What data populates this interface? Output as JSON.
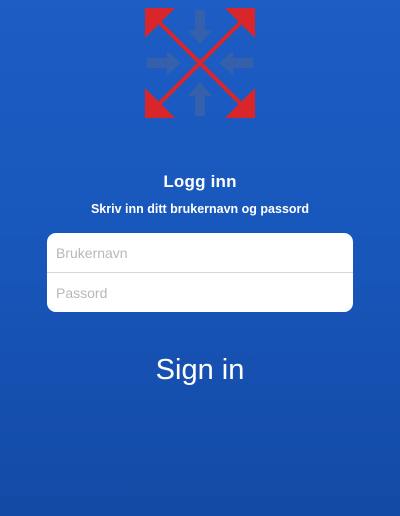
{
  "logo": {
    "icon": "arrows-cross-logo-icon",
    "colors": {
      "red": "#d9262a",
      "blue": "#3a62a8"
    }
  },
  "login": {
    "title": "Logg inn",
    "subtitle": "Skriv inn ditt brukernavn og passord",
    "username": {
      "value": "",
      "placeholder": "Brukernavn"
    },
    "password": {
      "value": "",
      "placeholder": "Passord"
    },
    "signin_label": "Sign in"
  },
  "colors": {
    "background": "#1857bb",
    "card": "#ffffff",
    "placeholder": "#b8b8bc"
  }
}
